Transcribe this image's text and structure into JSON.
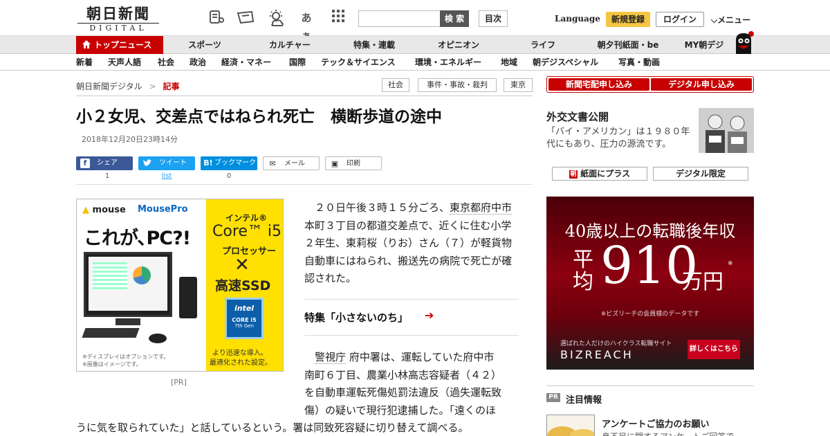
{
  "header": {
    "logo_jp": "朝日新聞",
    "logo_en": "DIGITAL",
    "icons": [
      "news-icon",
      "paper-icon",
      "weather-icon",
      "font-size-icon",
      "grid-icon"
    ],
    "font_icon_text": "あぁ",
    "search_placeholder": "",
    "search_button": "検 索",
    "toc_button": "目次",
    "language": "Language",
    "register": "新規登録",
    "login": "ログイン",
    "menu": "メニュー"
  },
  "nav_primary": {
    "top_news": "トップニュース",
    "items": [
      "スポーツ",
      "カルチャー",
      "特集・連載",
      "オピニオン",
      "ライフ",
      "朝夕刊紙面・be",
      "MY朝デジ"
    ]
  },
  "nav_secondary": {
    "items": [
      "新着",
      "天声人語",
      "社会",
      "政治",
      "経済・マネー",
      "国際",
      "テック＆サイエンス",
      "環境・エネルギー",
      "地域",
      "朝デジスペシャル",
      "写真・動画"
    ]
  },
  "breadcrumb": {
    "root": "朝日新聞デジタル",
    "sep": ">",
    "current": "記事"
  },
  "tags": [
    "社会",
    "事件・事故・裁判",
    "東京"
  ],
  "article": {
    "title": "小２女児、交差点ではねられ死亡　横断歩道の途中",
    "date": "2018年12月20日23時14分",
    "share": [
      {
        "label": "シェア",
        "count": "1",
        "icon": "f"
      },
      {
        "label": "ツイート",
        "count": "list",
        "icon": "t"
      },
      {
        "label": "ブックマーク",
        "count": "0",
        "icon": "B!"
      },
      {
        "label": "メール",
        "count": "",
        "icon": "✉"
      },
      {
        "label": "印刷",
        "count": "",
        "icon": "▣"
      }
    ],
    "p1_indent": "　２０日午後３時１５分ごろ、",
    "p1_link": "東京都府中市",
    "p1_rest": "本町３丁目の都道交差点で、近くに住む小学２年生、東莉桜（りお）さん（７）が軽貨物自動車にはねられ、搬送先の病院で死亡が確認された。",
    "feature": "特集「小さないのち」",
    "p2_indent": "　",
    "p2_link": "警視庁",
    "p2_line1_rest": "府中署は、運転していた府中市",
    "p2_lines": [
      "南町６丁目、農業小林高志容疑者（４２）",
      "を自動車運転死傷処罰法違反（過失運転致",
      "傷）の疑いで現行犯逮捕した。「遠くのほ"
    ],
    "p2_last": "うに気を取られていた」と話しているという。署は同致死容疑に切り替えて調べる。"
  },
  "ad_left": {
    "brand": "mouse",
    "brand2": "MousePro",
    "headline": "これが､PC?!",
    "intel": "インテル®",
    "core": "Core™ i5",
    "processor": "プロセッサー",
    "cross": "✕",
    "ssd": "高速SSD",
    "chip_brand": "intel",
    "chip_line1": "CORE i5",
    "chip_line2": "7th Gen",
    "tagline1": "より迅速な導入。",
    "tagline2": "最適化された設定。",
    "note1": "※ディスプレイはオプションです。",
    "note2": "※画像はイメージです。",
    "pr_label": "[PR]"
  },
  "right": {
    "sub_delivery": "新聞宅配申し込み",
    "sub_digital": "デジタル申し込み",
    "diplo_title": "外交文書公開",
    "diplo_desc": "「バイ・アメリカン」は１９８０年代にもあり、圧力の源流です。",
    "paper_plus": "紙面にプラス",
    "digital_only": "デジタル限定",
    "attention_badge": "PR",
    "attention": "注目情報",
    "enquete_title": "アンケートご協力のお願い",
    "enquete_desc": "息不足に関するアンケートご回答で"
  },
  "biz_ad": {
    "headline": "40歳以上の転職後年収",
    "avg1": "平",
    "avg2": "均",
    "amount": "910",
    "unit": "万円",
    "mark": "※",
    "note": "※ビズリーチの会員様のデータです",
    "tag": "選ばれた人だけのハイクラス転職サイト",
    "brand": "BIZREACH",
    "cta": "詳しくはこちら"
  },
  "colors": {
    "brand_red": "#c80000",
    "register_yellow": "#f5c542",
    "ad_yellow": "#ffe000"
  }
}
